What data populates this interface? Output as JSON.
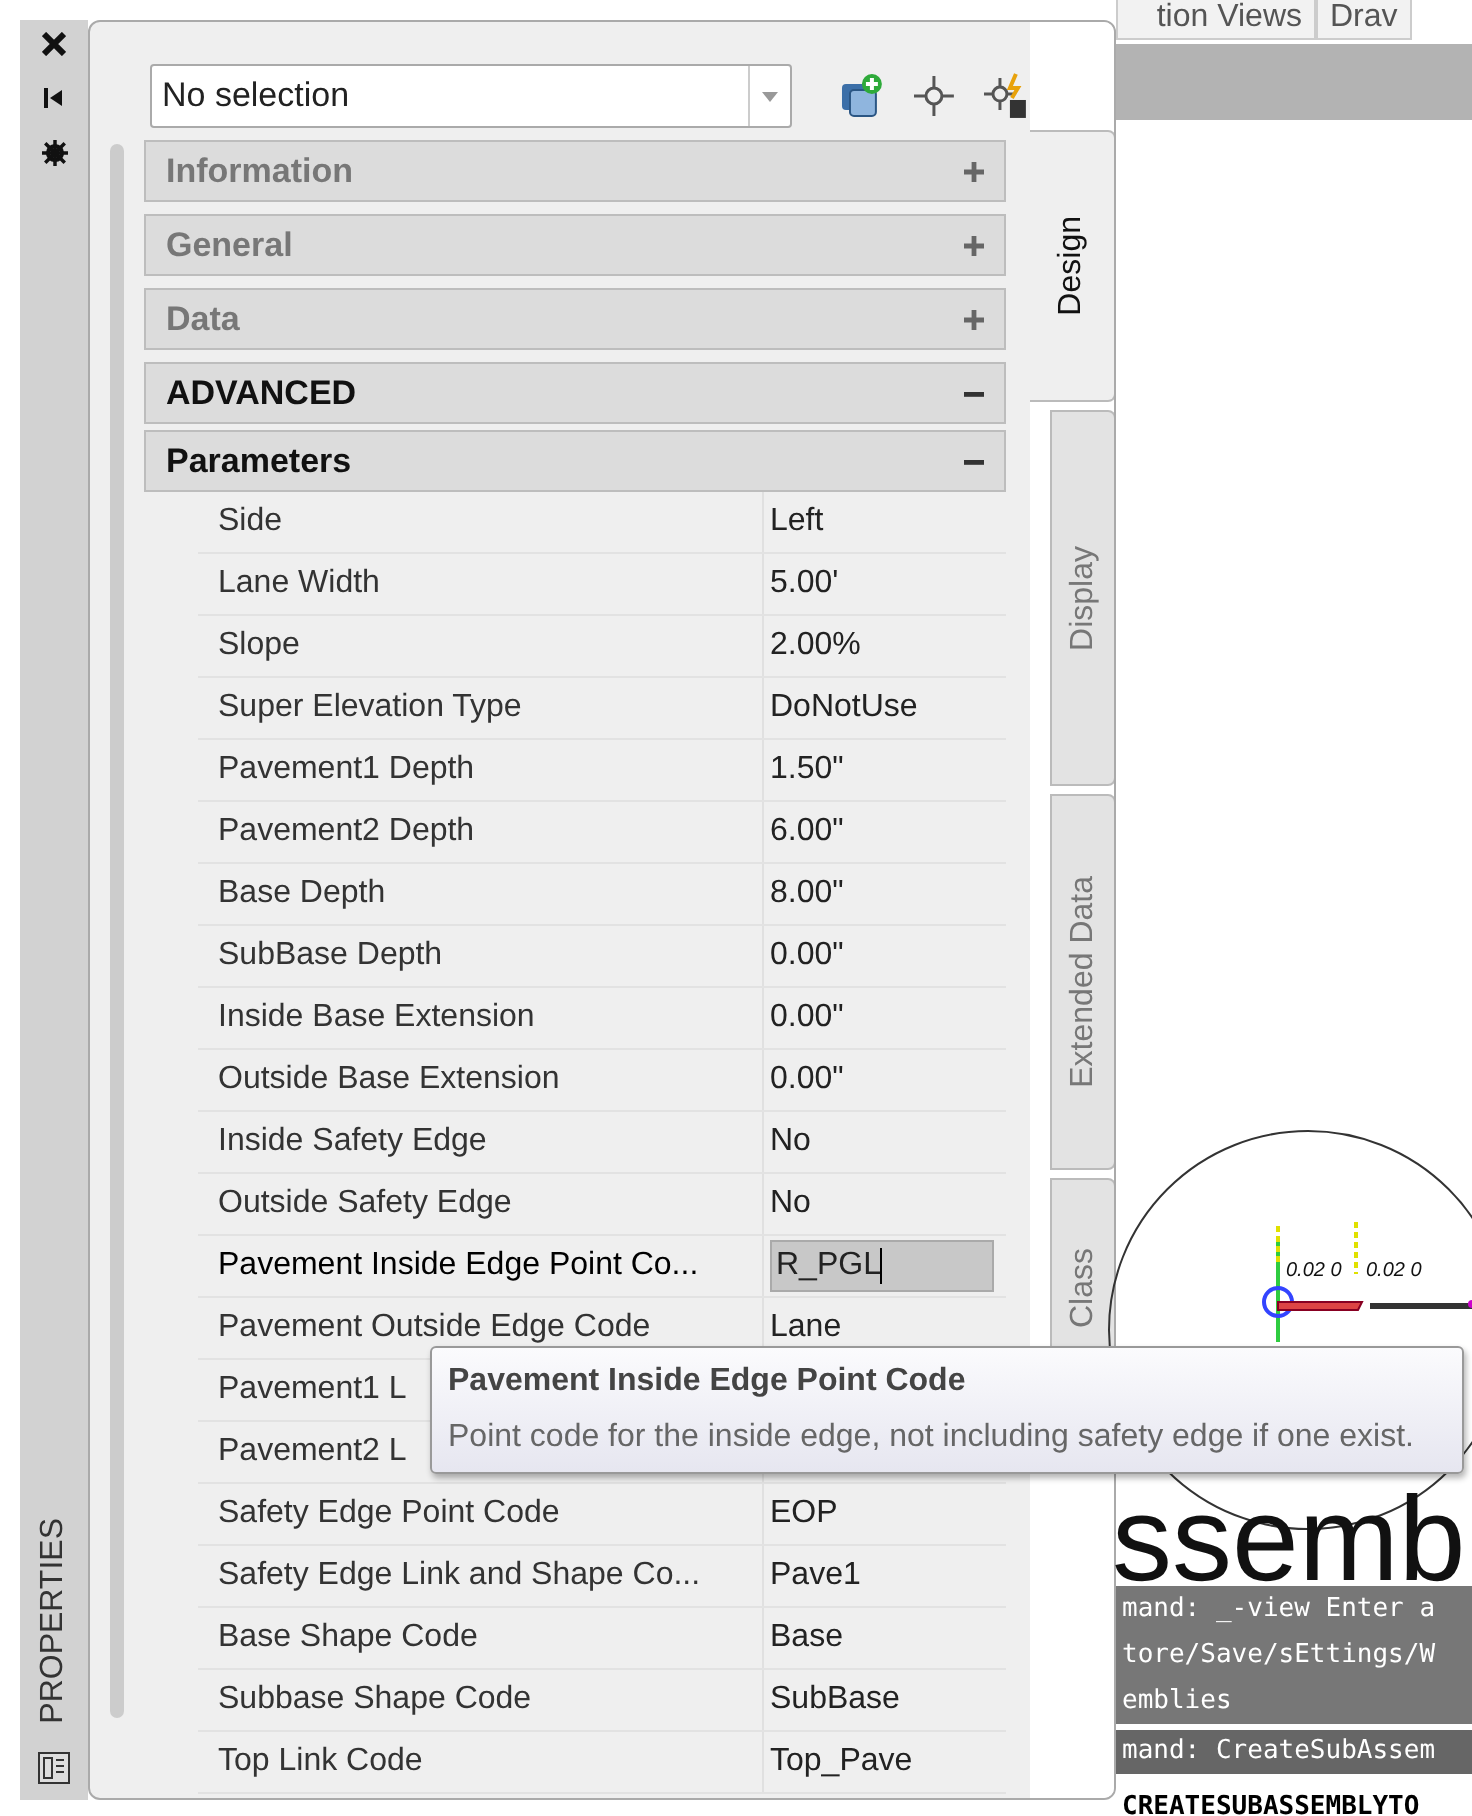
{
  "side_strip": {
    "title": "PROPERTIES"
  },
  "selector": {
    "value": "No selection"
  },
  "categories": [
    {
      "label": "Information",
      "expanded": false
    },
    {
      "label": "General",
      "expanded": false
    },
    {
      "label": "Data",
      "expanded": false
    },
    {
      "label": "ADVANCED",
      "expanded": true,
      "groups": [
        {
          "label": "Parameters",
          "expanded": true,
          "rows": [
            {
              "name": "Side",
              "value": "Left",
              "selected": false
            },
            {
              "name": "Lane Width",
              "value": "5.00'",
              "selected": false
            },
            {
              "name": "Slope",
              "value": "2.00%",
              "selected": false
            },
            {
              "name": "Super Elevation Type",
              "value": "DoNotUse",
              "selected": false
            },
            {
              "name": "Pavement1 Depth",
              "value": "1.50\"",
              "selected": false
            },
            {
              "name": "Pavement2 Depth",
              "value": "6.00\"",
              "selected": false
            },
            {
              "name": "Base Depth",
              "value": "8.00\"",
              "selected": false
            },
            {
              "name": "SubBase Depth",
              "value": "0.00\"",
              "selected": false
            },
            {
              "name": "Inside Base Extension",
              "value": "0.00\"",
              "selected": false
            },
            {
              "name": "Outside Base Extension",
              "value": "0.00\"",
              "selected": false
            },
            {
              "name": "Inside Safety Edge",
              "value": "No",
              "selected": false
            },
            {
              "name": "Outside Safety Edge",
              "value": "No",
              "selected": false
            },
            {
              "name": "Pavement Inside Edge Point Co...",
              "value": "R_PGL",
              "selected": true
            },
            {
              "name": "Pavement Outside Edge Code",
              "value": "Lane",
              "selected": false
            },
            {
              "name": "Pavement1 L",
              "selected": false
            },
            {
              "name": "Pavement2 L",
              "selected": false
            },
            {
              "name": "Safety Edge Point Code",
              "value": "EOP",
              "selected": false
            },
            {
              "name": "Safety Edge Link and Shape Co...",
              "value": "Pave1",
              "selected": false
            },
            {
              "name": "Base Shape Code",
              "value": "Base",
              "selected": false
            },
            {
              "name": "Subbase Shape Code",
              "value": "SubBase",
              "selected": false
            },
            {
              "name": "Top Link Code",
              "value": "Top_Pave",
              "selected": false
            }
          ]
        }
      ]
    }
  ],
  "side_tabs": [
    {
      "label": "Design",
      "selected": true
    },
    {
      "label": "Display",
      "selected": false
    },
    {
      "label": "Extended Data",
      "selected": false
    },
    {
      "label": "Class",
      "selected": false
    }
  ],
  "tooltip": {
    "title": "Pavement Inside Edge Point Code",
    "text": "Point code for the inside edge, not including safety edge if one exist."
  },
  "drawing_tabs": [
    "tion Views",
    "Drav"
  ],
  "canvas": {
    "big_text": "ssemb",
    "dimension_labels": [
      "0.02 0",
      "0.02 0"
    ]
  },
  "command_lines": [
    {
      "text": "mand: _-view Enter a",
      "kind": "history"
    },
    {
      "text": "tore/Save/sEttings/W",
      "kind": "history"
    },
    {
      "text": "emblies",
      "kind": "history"
    },
    {
      "text": "mand: CreateSubAssem",
      "kind": "last"
    },
    {
      "text": "CREATESUBASSEMBLYTO",
      "kind": "input"
    }
  ]
}
